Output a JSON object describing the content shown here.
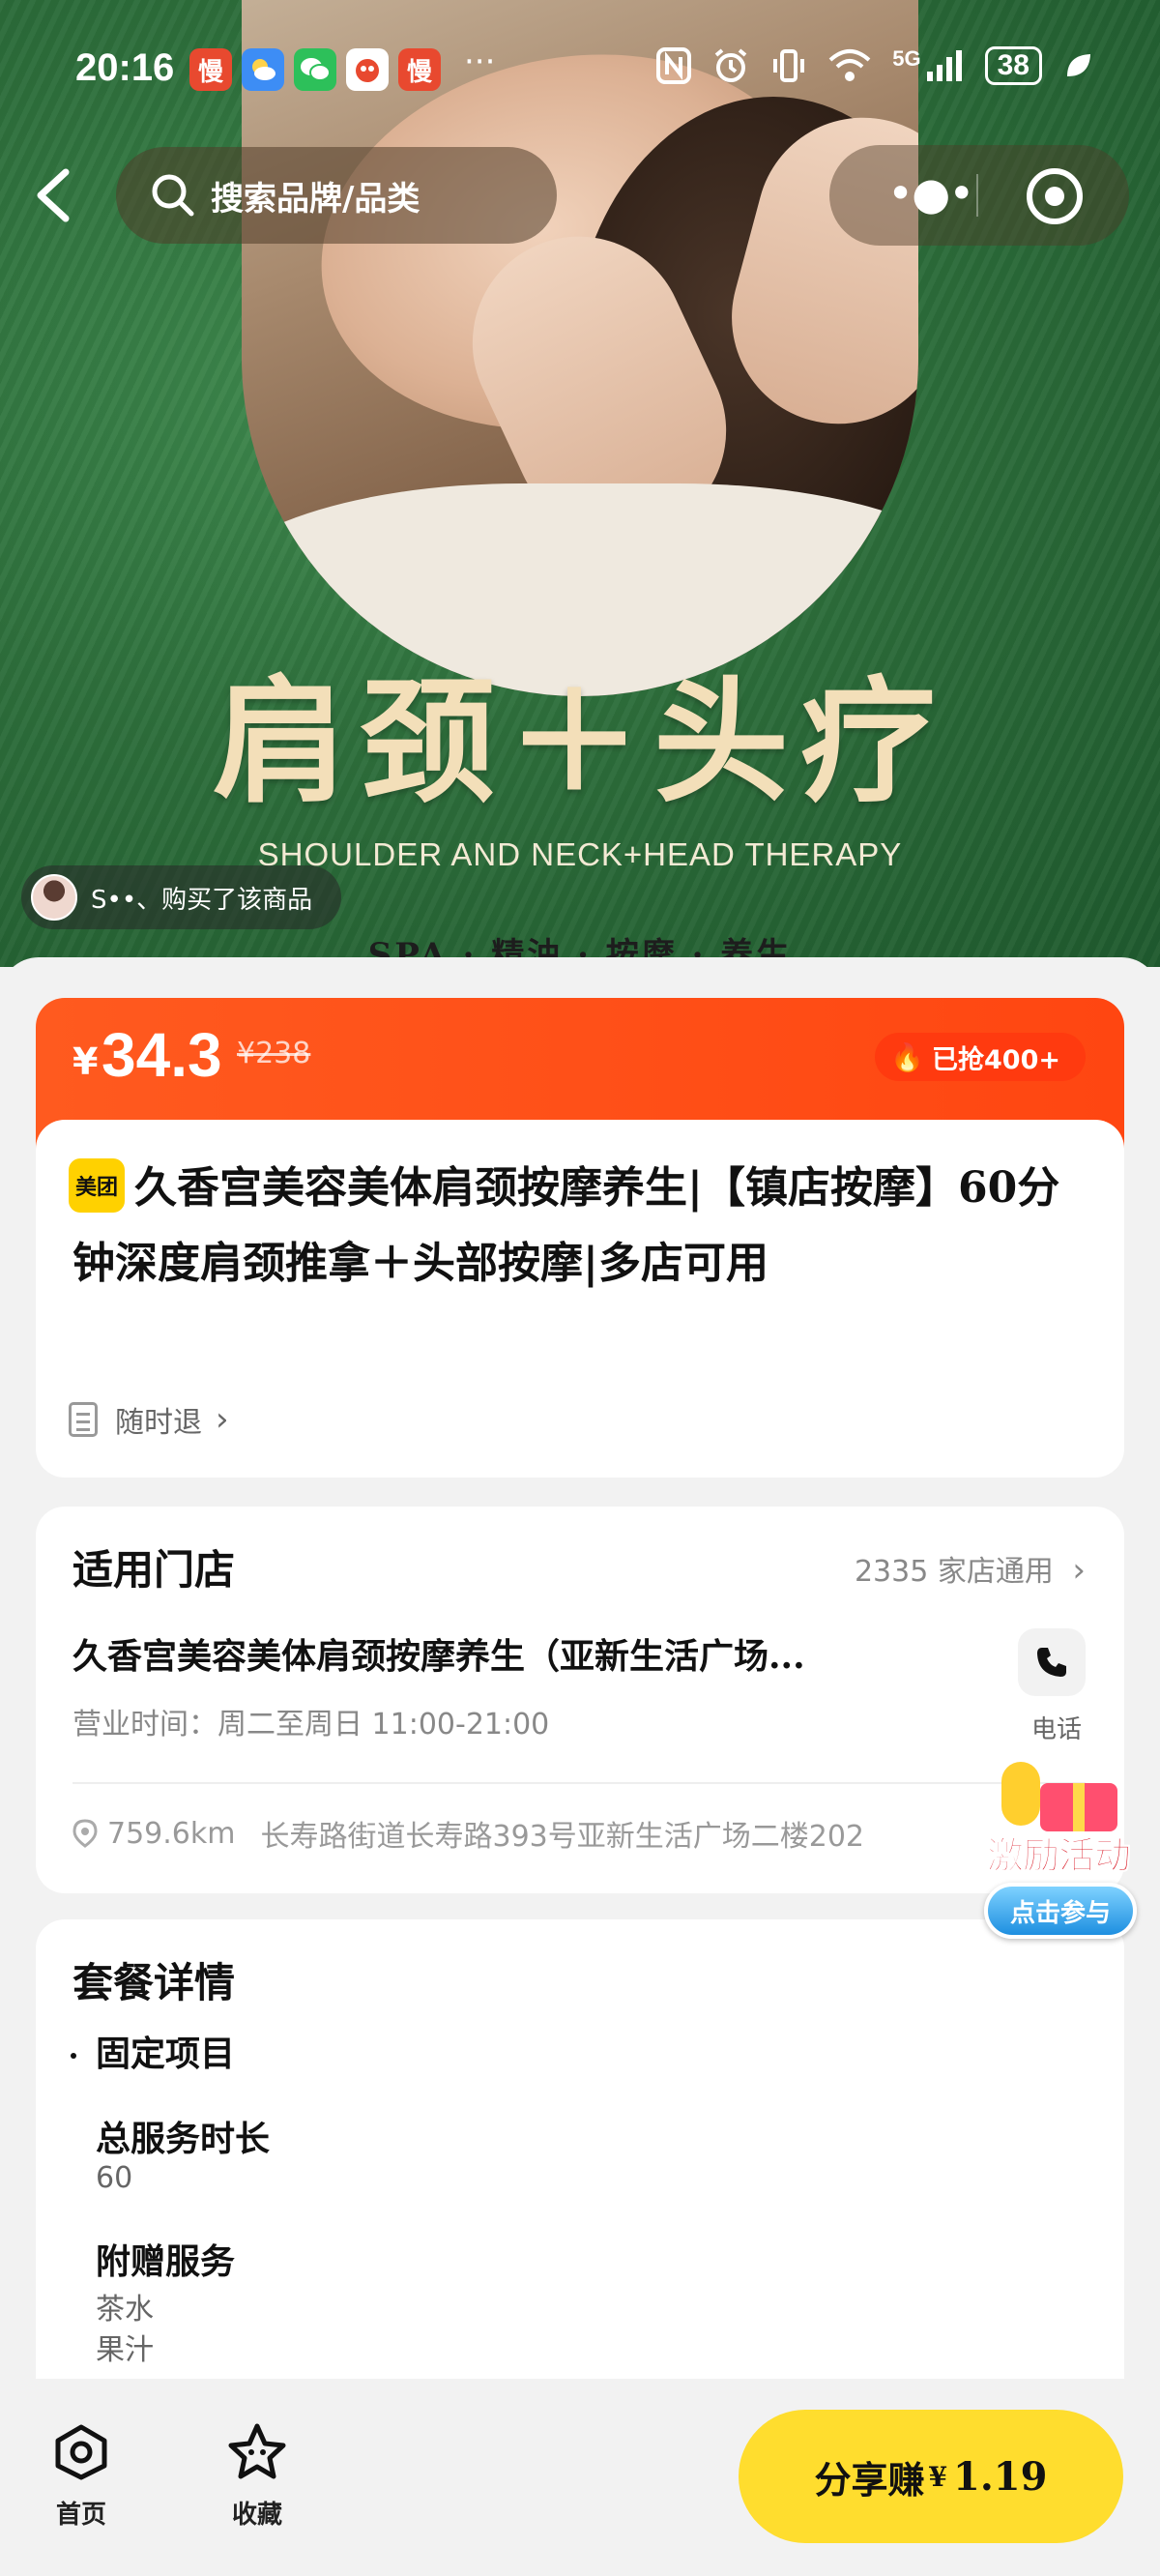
{
  "status_bar": {
    "time": "20:16",
    "app_icons": [
      {
        "icon": "slow-app-icon",
        "label": "慢",
        "color": "#e8492f"
      },
      {
        "icon": "weather-app-icon",
        "label": "",
        "color": "#3d8df5"
      },
      {
        "icon": "wechat-app-icon",
        "label": "",
        "color": "#2dc05a"
      },
      {
        "icon": "mascot-app-icon",
        "label": "",
        "color": "#e8492f"
      },
      {
        "icon": "slow-app-icon",
        "label": "慢",
        "color": "#e8492f"
      }
    ],
    "more": "···",
    "network": "5G",
    "battery": "38"
  },
  "nav": {
    "search_placeholder": "搜索品牌/品类"
  },
  "hero": {
    "title": "肩颈＋头疗",
    "subtitle": "SHOULDER AND NECK+HEAD THERAPY",
    "tags": "SPA · 精油 · 按摩 · 养生",
    "buyer_note": "S••、购买了该商品"
  },
  "price": {
    "currency": "¥",
    "current": "34.3",
    "original": "¥238",
    "sold": "已抢400+"
  },
  "product": {
    "badge": "美团",
    "title": "久香宫美容美体肩颈按摩养生|【镇店按摩】60分钟深度肩颈推拿＋头部按摩|多店可用",
    "refund": "随时退"
  },
  "store": {
    "heading": "适用门店",
    "count": "2335 家店通用",
    "name": "久香宫美容美体肩颈按摩养生（亚新生活广场...",
    "hours": "营业时间：周二至周日 11:00-21:00",
    "phone_label": "电话",
    "distance": "759.6km",
    "address": "长寿路街道长寿路393号亚新生活广场二楼202"
  },
  "package": {
    "heading": "套餐详情",
    "section": "固定项目",
    "items": [
      {
        "label": "总服务时长",
        "values": [
          "60"
        ]
      },
      {
        "label": "附赠服务",
        "values": [
          "茶水",
          "果汁"
        ]
      }
    ]
  },
  "promo": {
    "title": "激励活动",
    "button": "点击参与"
  },
  "bottom": {
    "home_label": "首页",
    "fav_label": "收藏",
    "share_text": "分享赚",
    "share_currency": "¥",
    "share_amount": "1.19"
  },
  "colors": {
    "accent_orange": "#ff4f17",
    "brand_yellow": "#ffd100",
    "hero_green": "#2d6e3b"
  }
}
